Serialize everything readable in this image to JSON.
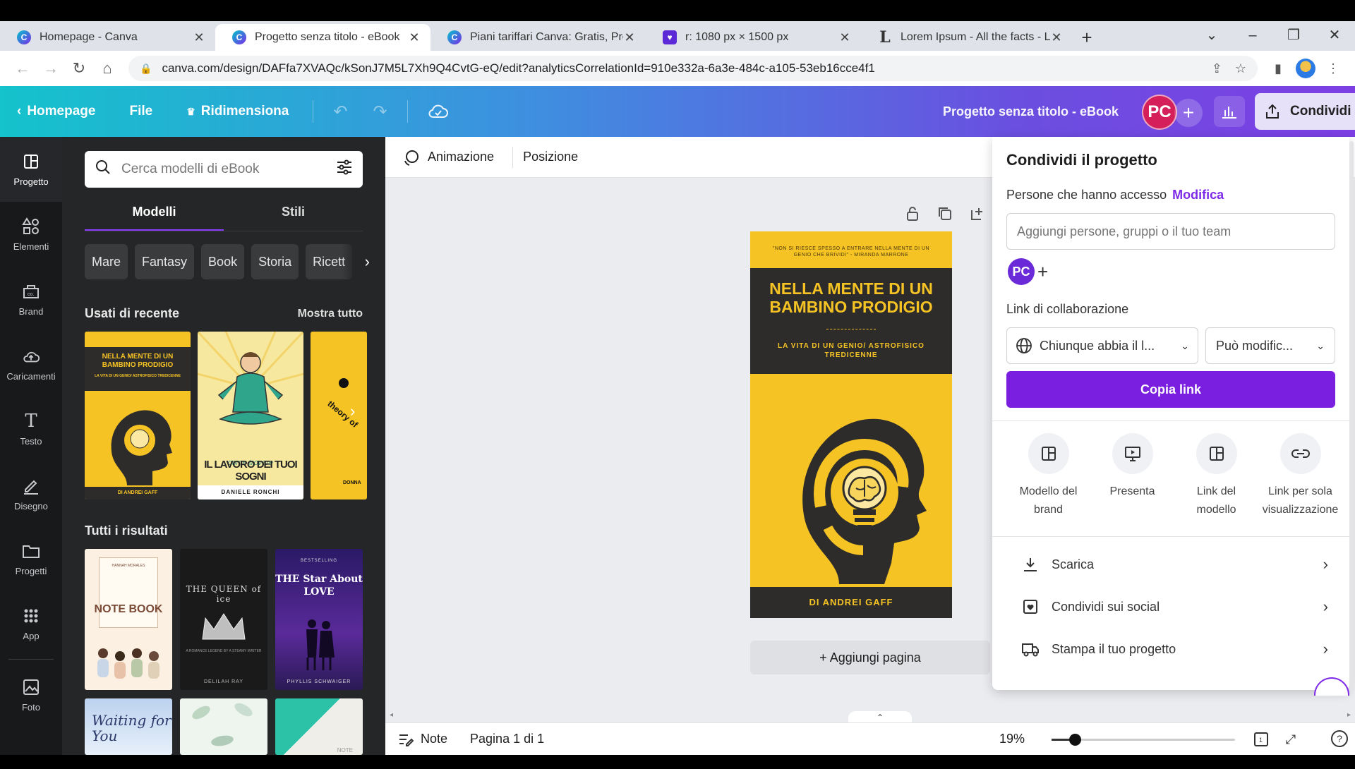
{
  "browser": {
    "tabs": [
      {
        "title": "Homepage - Canva",
        "favicon": "canva-icon"
      },
      {
        "title": "Progetto senza titolo - eBook",
        "favicon": "canva-icon",
        "active": true
      },
      {
        "title": "Piani tariffari Canva: Gratis, Pro e",
        "favicon": "canva-icon"
      },
      {
        "title": "r: 1080 px × 1500 px",
        "favicon": "chat-icon"
      },
      {
        "title": "Lorem Ipsum - All the facts - Lips",
        "favicon": "lorem-icon"
      }
    ],
    "url": "canva.com/design/DAFfa7XVAQc/kSonJ7M5L7Xh9Q4CvtG-eQ/edit?analyticsCorrelationId=910e332a-6a3e-484c-a105-53eb16cce4f1"
  },
  "header": {
    "back_label": "Homepage",
    "file_label": "File",
    "resize_label": "Ridimensiona",
    "doc_title": "Progetto senza titolo - eBook",
    "avatar_initials": "PC",
    "share_label": "Condividi",
    "gradient": [
      "#14c3cc",
      "#7d3fe4"
    ]
  },
  "rail": [
    {
      "label": "Progetto",
      "icon": "layout-icon",
      "active": true
    },
    {
      "label": "Elementi",
      "icon": "shapes-icon"
    },
    {
      "label": "Brand",
      "icon": "brand-icon"
    },
    {
      "label": "Caricamenti",
      "icon": "upload-cloud-icon"
    },
    {
      "label": "Testo",
      "icon": "text-icon"
    },
    {
      "label": "Disegno",
      "icon": "draw-icon"
    },
    {
      "label": "Progetti",
      "icon": "folder-icon"
    },
    {
      "label": "App",
      "icon": "apps-grid-icon"
    },
    {
      "label": "Foto",
      "icon": "photo-icon"
    }
  ],
  "panel": {
    "search_placeholder": "Cerca modelli di eBook",
    "tabs": [
      "Modelli",
      "Stili"
    ],
    "chips": [
      "Mare",
      "Fantasy",
      "Book",
      "Storia",
      "Ricett"
    ],
    "recent_title": "Usati di recente",
    "recent_link": "Mostra tutto",
    "all_title": "Tutti i risultati",
    "recent_thumbs": [
      {
        "title": "NELLA MENTE DI UN BAMBINO PRODIGIO",
        "subtitle": "LA VITA DI UN GENIO/ ASTROFISICO TREDICENNE",
        "footer": "DI ANDREI GAFF"
      },
      {
        "title": "IL LAVORO DEI TUOI SOGNI",
        "subtitle": "come trovare",
        "footer": "DANIELE RONCHI"
      },
      {
        "title": "theory of",
        "footer": "DONNA"
      }
    ],
    "result_thumbs": [
      {
        "title": "NOTE BOOK",
        "top": "HANNAH MORALES"
      },
      {
        "title": "THE QUEEN of ice",
        "footer": "DELILAH RAY",
        "subtitle": "A ROMANCE LEGEND BY A STEAMY WRITER"
      },
      {
        "title": "THE Star About LOVE",
        "top": "BESTSELLING",
        "footer": "PHYLLIS SCHWAIGER"
      },
      {
        "title": "Waiting for You"
      },
      {
        "title": ""
      },
      {
        "title": "NOTE"
      }
    ]
  },
  "canvas": {
    "toolbar": {
      "animation": "Animazione",
      "position": "Posizione"
    },
    "book": {
      "quote": "\"NON SI RIESCE SPESSO A ENTRARE NELLA MENTE DI UN GENIO CHE BRIVIDI\" - MIRANDA MARRONE",
      "title": "NELLA MENTE DI UN BAMBINO PRODIGIO",
      "subtitle": "LA VITA DI UN GENIO/ ASTROFISICO TREDICENNE",
      "author": "DI ANDREI GAFF",
      "colors": {
        "yellow": "#f6c324",
        "dark": "#2d2c2b"
      }
    },
    "add_page": "+ Aggiungi pagina",
    "bottom": {
      "notes": "Note",
      "page": "Pagina 1 di 1",
      "zoom": "19%",
      "zoom_level": 0.19
    }
  },
  "share": {
    "title": "Condividi il progetto",
    "access_label": "Persone che hanno accesso",
    "access_edit": "Modifica",
    "add_placeholder": "Aggiungi persone, gruppi o il tuo team",
    "avatar_initials": "PC",
    "collab_label": "Link di collaborazione",
    "link_scope": "Chiunque abbia il l...",
    "link_permission": "Può modific...",
    "copy_label": "Copia link",
    "options": [
      {
        "line1": "Modello del",
        "line2": "brand",
        "icon": "brand-template-icon"
      },
      {
        "line1": "Presenta",
        "line2": "",
        "icon": "present-icon"
      },
      {
        "line1": "Link del",
        "line2": "modello",
        "icon": "template-link-icon"
      },
      {
        "line1": "Link per sola",
        "line2": "visualizzazione",
        "icon": "view-link-icon"
      }
    ],
    "rows": [
      {
        "label": "Scarica",
        "icon": "download-icon"
      },
      {
        "label": "Condividi sui social",
        "icon": "social-heart-icon"
      },
      {
        "label": "Stampa il tuo progetto",
        "icon": "truck-icon"
      }
    ],
    "accent": "#7a1ee0"
  }
}
